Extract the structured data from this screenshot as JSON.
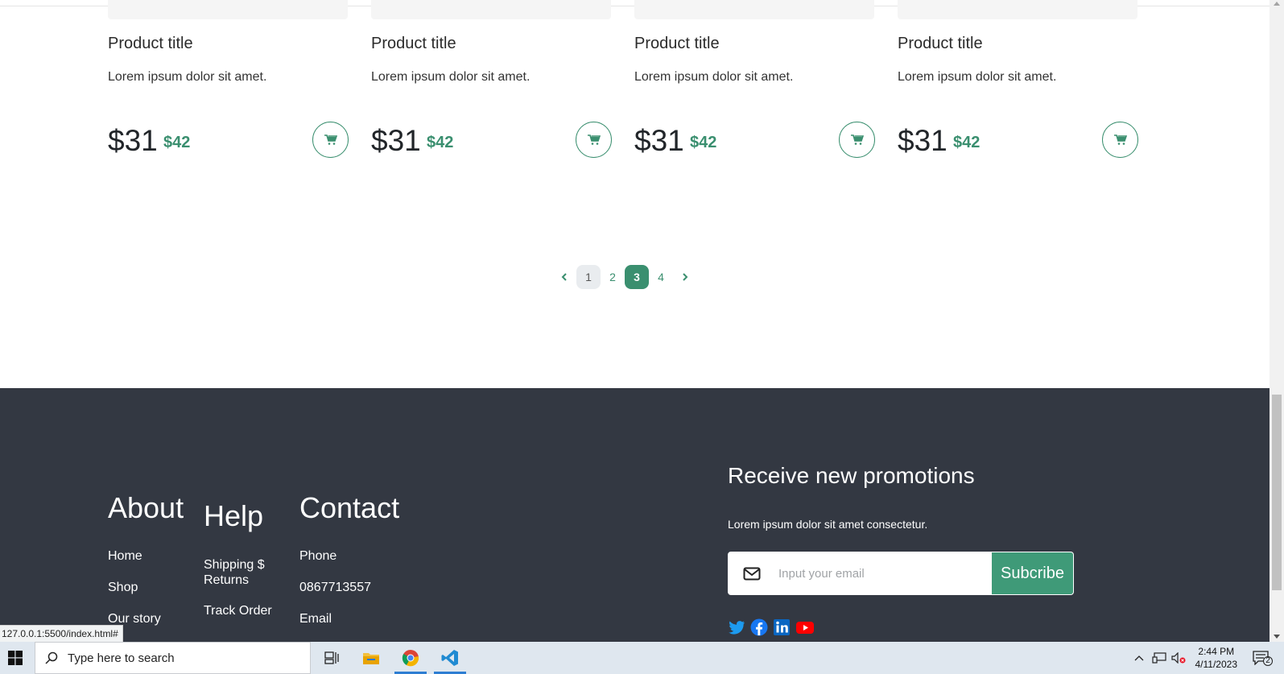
{
  "products": [
    {
      "title": "Product title",
      "description": "Lorem ipsum dolor sit amet.",
      "price": "$31",
      "old_price": "$42"
    },
    {
      "title": "Product title",
      "description": "Lorem ipsum dolor sit amet.",
      "price": "$31",
      "old_price": "$42"
    },
    {
      "title": "Product title",
      "description": "Lorem ipsum dolor sit amet.",
      "price": "$31",
      "old_price": "$42"
    },
    {
      "title": "Product title",
      "description": "Lorem ipsum dolor sit amet.",
      "price": "$31",
      "old_price": "$42"
    }
  ],
  "pagination": {
    "prev_icon": "chevron-left-icon",
    "pages": [
      "1",
      "2",
      "3",
      "4"
    ],
    "active_page": "3",
    "next_icon": "chevron-right-icon"
  },
  "footer": {
    "about": {
      "heading": "About",
      "links": [
        "Home",
        "Shop",
        "Our story"
      ]
    },
    "help": {
      "heading": "Help",
      "links": [
        "Shipping $ Returns",
        "Track Order"
      ]
    },
    "contact": {
      "heading": "Contact",
      "items": [
        "Phone",
        "0867713557",
        "Email"
      ]
    },
    "promo": {
      "title": "Receive new promotions",
      "description": "Lorem ipsum dolor sit amet consectetur.",
      "email_placeholder": "Input your email",
      "button_label": "Subcribe"
    },
    "socials": [
      "twitter-icon",
      "facebook-icon",
      "linkedin-icon",
      "youtube-icon"
    ]
  },
  "status_url": "127.0.0.1:5500/index.html#",
  "colors": {
    "accent": "#3a8f6f",
    "footer_bg": "#333842"
  },
  "taskbar": {
    "search_placeholder": "Type here to search",
    "time": "2:44 PM",
    "date": "4/11/2023",
    "notification_count": "2"
  }
}
